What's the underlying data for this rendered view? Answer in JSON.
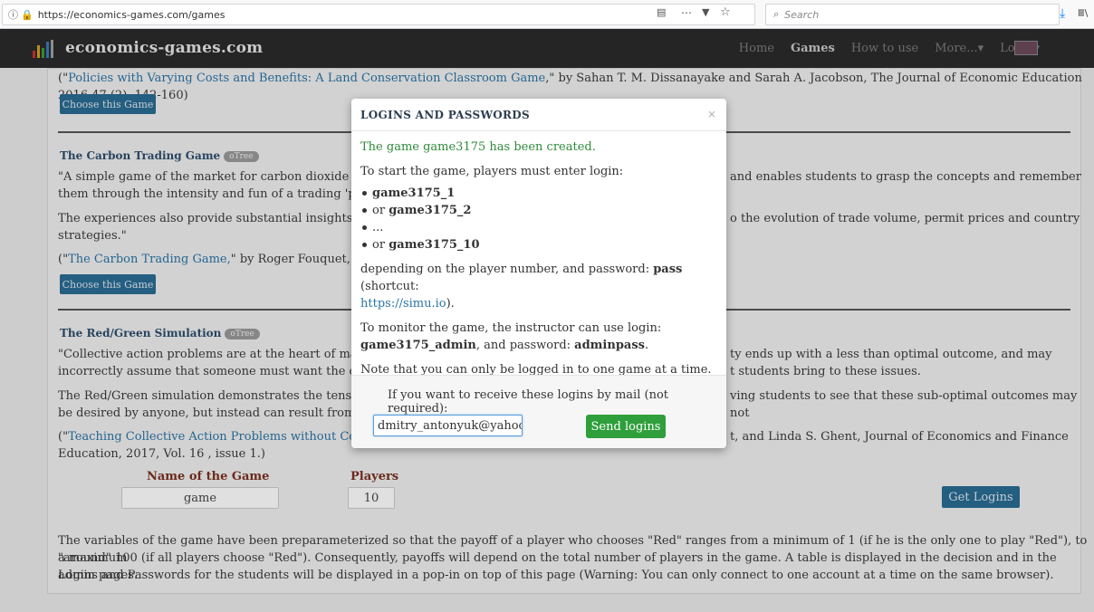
{
  "browser": {
    "url": "https://economics-games.com/games",
    "search_placeholder": "Search",
    "reader_icon": "reader-icon",
    "more_icon": "⋯",
    "pocket_icon": "▼",
    "star_icon": "☆"
  },
  "navbar": {
    "brand": "economics-games.com",
    "links": [
      "Home",
      "Games",
      "How to use",
      "More...▾",
      "Login▾"
    ]
  },
  "sections": {
    "citation1_link": "Policies with Varying Costs and Benefits: A Land Conservation Classroom Game",
    "citation1_rest": ",\" by Sahan T. M. Dissanayake and Sarah A. Jacobson, The Journal of Economic Education 2016 47 (2), 142-160)",
    "choose_label": "Choose this Game",
    "carbon_title": "The Carbon Trading Game",
    "free_label": "oTree",
    "carbon_p1a": "\"A simple game of the market for carbon dioxide tradab",
    "carbon_p1b": "and enables students to grasp the concepts and remember",
    "carbon_p1c": "them through the intensity and fun of a trading 'pit'.",
    "carbon_p2a": "The experiences also provide substantial insights into t",
    "carbon_p2b": "o the evolution of trade volume, permit prices and country",
    "carbon_p2c": "strategies.\"",
    "carbon_cite_link": "The Carbon Trading Game,",
    "carbon_cite_rest": "\" by Roger Fouquet, Climat",
    "redgreen_title": "The Red/Green Simulation",
    "rg_p1a": "\"Collective action problems are at the heart of many ec",
    "rg_p1b": "ty ends up with a less than optimal outcome, and may",
    "rg_p1c": "incorrectly assume that someone must want the outco",
    "rg_p1d": "t students bring to these issues.",
    "rg_p2a": "The Red/Green simulation demonstrates the tension b",
    "rg_p2b": "ving students to see that these sub-optimal outcomes may not",
    "rg_p2c": "be desired by anyone, but instead can result from unhe",
    "rg_cite_link": "Teaching Collective Action Problems without Context",
    "rg_cite_rest": "t, and Linda S. Ghent, Journal of Economics and Finance",
    "rg_cite_line2": "Education, 2017, Vol. 16 , issue 1.)",
    "name_label": "Name of the Game",
    "players_label": "Players",
    "name_value": "game",
    "players_value": "10",
    "get_logins": "Get Logins",
    "bottom_p1": "The variables of the game have been preparameterized so that the payoff of a player who chooses \"Red\" ranges from a minimum of 1 (if he is the only one to play \"Red\"), to a maximum",
    "bottom_p2": "\"around\" 100 (if all players choose \"Red\"). Consequently, payoffs will depend on the total number of players in the game. A table is displayed in the decision and in the admin pages.",
    "bottom_p3": "Logins and Passwords for the students will be displayed in a pop-in on top of this page (Warning: You can only connect to one account at a time on the same browser)."
  },
  "modal": {
    "title": "LOGINS AND PASSWORDS",
    "close": "×",
    "created": "The game game3175 has been created.",
    "start_text": "To start the game, players must enter login:",
    "login1": "game3175_1",
    "or": "or ",
    "login2": "game3175_2",
    "ellipsis": "...",
    "login10": "game3175_10",
    "depending": "depending on the player number, and password: ",
    "password": "pass",
    "shortcut_text": " (shortcut:",
    "shortcut_link": "https://simu.io",
    "period": ").",
    "monitor_text": "To monitor the game, the instructor can use login:",
    "admin_login": "game3175_admin",
    "admin_mid": ", and password: ",
    "admin_pass": "adminpass",
    "dot": ".",
    "note": "Note that you can only be logged in to one game at a time.",
    "mail_prompt": "If you want to receive these logins by mail (not required):",
    "mail_value": "dmitry_antonyuk@yahoo.",
    "send_label": "Send logins"
  }
}
